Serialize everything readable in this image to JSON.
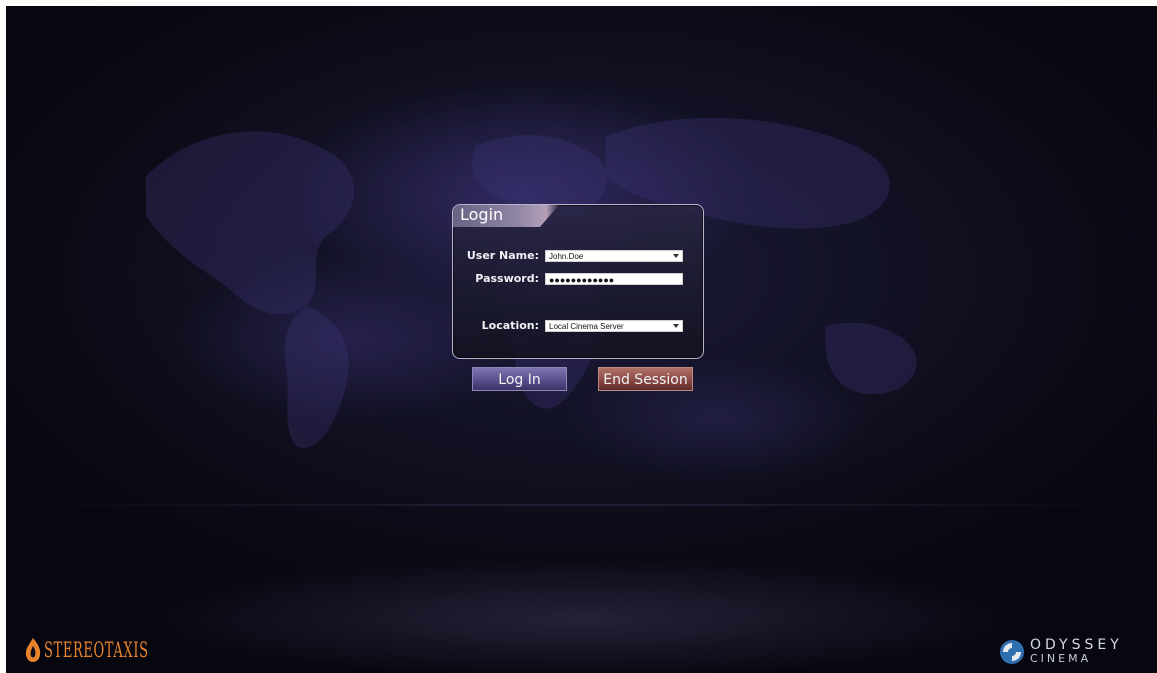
{
  "login": {
    "title": "Login",
    "username_label": "User Name:",
    "username_value": "John.Doe",
    "password_label": "Password:",
    "password_value": "●●●●●●●●●●●●",
    "location_label": "Location:",
    "location_value": "Local Cinema Server"
  },
  "actions": {
    "login_label": "Log In",
    "end_session_label": "End Session"
  },
  "branding": {
    "left_logo_text": "STEREOTAXIS",
    "right_logo_name": "ODYSSEY",
    "right_logo_sub": "CINEMA",
    "right_logo_mark": "•"
  },
  "colors": {
    "background": "#0c0c18",
    "login_button": "#5b4f8d",
    "end_session_button": "#8a4a45",
    "stereotaxis_orange": "#e8832c"
  }
}
